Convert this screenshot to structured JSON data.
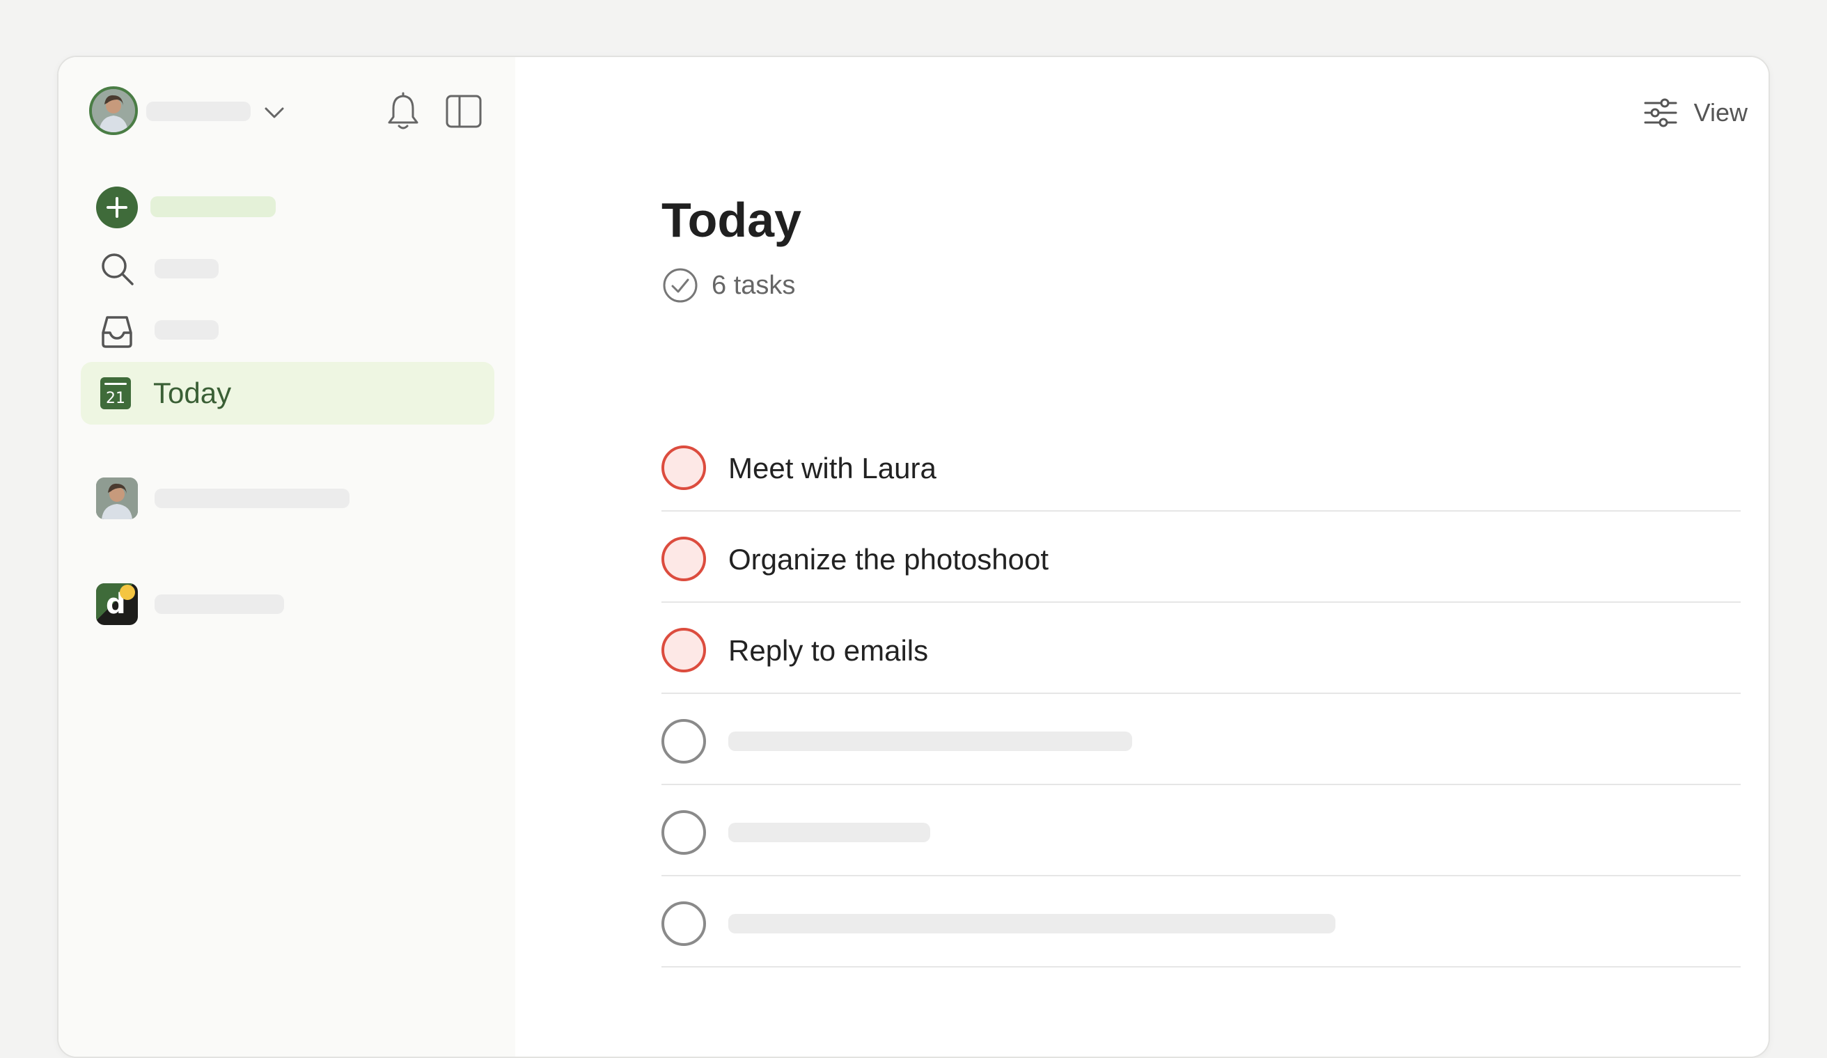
{
  "header": {
    "view_label": "View"
  },
  "sidebar": {
    "nav": {
      "today_label": "Today",
      "today_date": "21"
    },
    "projects": [
      {
        "icon": "user-avatar"
      },
      {
        "icon": "d-workspace-logo",
        "letter": "d"
      }
    ]
  },
  "main": {
    "title": "Today",
    "task_count": "6 tasks",
    "tasks": [
      {
        "text": "Meet with Laura",
        "priority": "p1"
      },
      {
        "text": "Organize the photoshoot",
        "priority": "p1"
      },
      {
        "text": "Reply to emails",
        "priority": "p1"
      },
      {
        "text": "",
        "priority": "none"
      },
      {
        "text": "",
        "priority": "none"
      },
      {
        "text": "",
        "priority": "none"
      }
    ]
  },
  "colors": {
    "accent_green": "#3f6b3a",
    "selected_bg": "#eef6e2",
    "priority1_red": "#dc4c3e",
    "priority1_fill": "#fde8e6"
  }
}
